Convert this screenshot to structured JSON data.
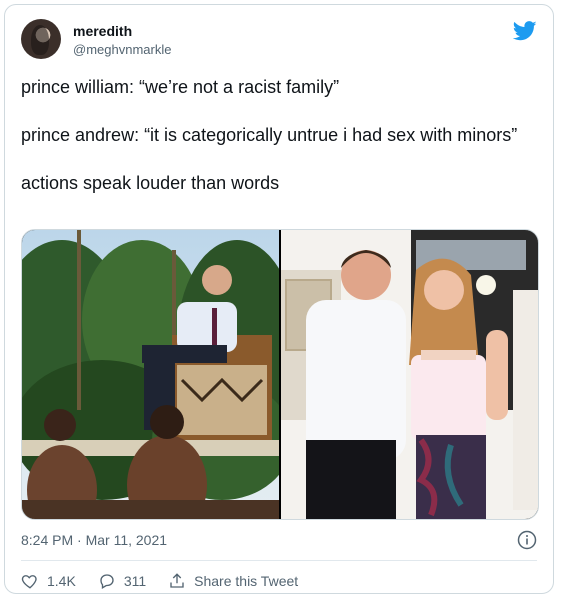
{
  "tweet": {
    "display_name": "meredith",
    "handle": "@meghvnmarkle",
    "paragraphs": [
      "prince william: “we’re not a racist family”",
      "prince andrew: “it is categorically untrue i had sex with minors”",
      "actions speak louder than words"
    ],
    "timestamp": "8:24 PM · Mar 11, 2021",
    "likes": "1.4K",
    "replies": "311",
    "share_label": "Share this Tweet"
  },
  "colors": {
    "twitter_blue": "#1d9bf0",
    "secondary_text": "#536471",
    "border": "#cfd9de"
  },
  "icons": [
    "twitter-bird-icon",
    "info-icon",
    "heart-icon",
    "reply-icon",
    "share-icon"
  ]
}
